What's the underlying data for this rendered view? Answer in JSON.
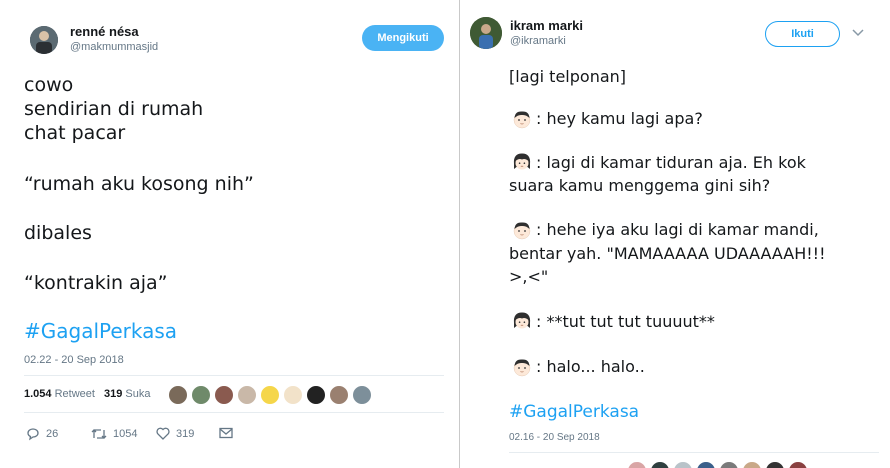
{
  "left_tweet": {
    "name": "renné nésa",
    "handle": "@makmummasjid",
    "follow_label": "Mengikuti",
    "lines": [
      "cowo",
      "sendirian di rumah",
      "chat pacar",
      "“rumah aku kosong nih”",
      "dibales",
      "“kontrakin aja”"
    ],
    "hashtag": "#GagalPerkasa",
    "timestamp": "02.22 - 20 Sep 2018",
    "retweets_count": "1.054",
    "retweets_label": "Retweet",
    "likes_count": "319",
    "likes_label": "Suka",
    "actions": {
      "replies": "26",
      "retweets": "1054",
      "likes": "319"
    }
  },
  "right_tweet": {
    "name": "ikram marki",
    "handle": "@ikramarki",
    "follow_label": "Ikuti",
    "intro": "[lagi telponan]",
    "dialogue": [
      {
        "speaker": "boy",
        "text": ":  hey kamu lagi apa?"
      },
      {
        "speaker": "girl",
        "text": ": lagi di kamar tiduran aja. Eh kok"
      },
      {
        "speaker": "none",
        "text": "suara kamu menggema gini sih?"
      },
      {
        "speaker": "boy",
        "text": ": hehe iya aku lagi di kamar mandi,"
      },
      {
        "speaker": "none",
        "text": "bentar yah. \"MAMAAAAA UDAAAAAH!!!"
      },
      {
        "speaker": "none",
        "text": ">,<\""
      },
      {
        "speaker": "girl",
        "text": ": **tut tut tut tuuuut**"
      },
      {
        "speaker": "boy",
        "text": ": halo... halo.."
      }
    ],
    "hashtag": "#GagalPerkasa",
    "timestamp": "02.16 - 20 Sep 2018"
  },
  "colors": {
    "accent": "#1da1f2",
    "follow_bg": "#4ab3f4",
    "muted": "#657786"
  },
  "icons": [
    "reply-icon",
    "retweet-icon",
    "like-icon",
    "message-icon",
    "chevron-down-icon",
    "boy-emoji-icon",
    "girl-emoji-icon"
  ]
}
